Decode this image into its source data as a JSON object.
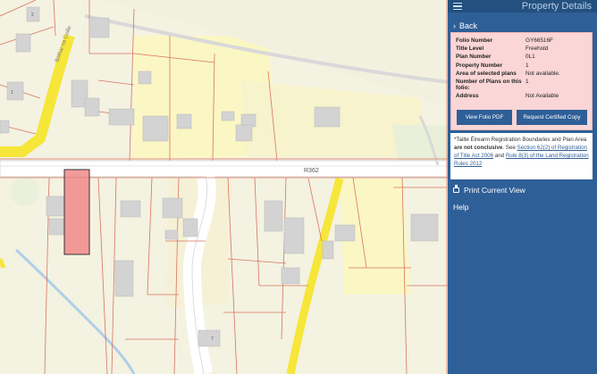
{
  "map": {
    "road_label": "R362",
    "street_label": "Bóthar na Coille"
  },
  "panel": {
    "title": "Property Details",
    "back_label": "Back",
    "details": [
      {
        "label": "Folio Number",
        "value": "GY66516F"
      },
      {
        "label": "Title Level",
        "value": "Freehold"
      },
      {
        "label": "Plan Number",
        "value": "0L1"
      },
      {
        "label": "Property Number",
        "value": "1"
      },
      {
        "label": "Area of selected plans",
        "value": "Not available."
      },
      {
        "label": "Number of Plans on this folio:",
        "value": "1"
      },
      {
        "label": "Address",
        "value": "Not Available"
      }
    ],
    "buttons": {
      "view_folio": "View Folio PDF",
      "request_copy": "Request Certified Copy"
    },
    "note": {
      "prefix": "*Tailte Éireann Registration Boundaries and Plan Area",
      "bold": "are not conclusive",
      "see": ". See",
      "link1": "Section 62(2) of Registration of Title Act 2006",
      "and": "and",
      "link2": "Rule 8(3) of the Land Registration Rules 2012"
    },
    "print_label": "Print Current View",
    "help_label": "Help"
  },
  "colors": {
    "panel_bg": "#2e5f97",
    "card_bg": "#fad6d6",
    "selected_parcel": "#f08a8a",
    "road_yellow": "#f6e63a",
    "map_bg": "#f4f2e1"
  }
}
